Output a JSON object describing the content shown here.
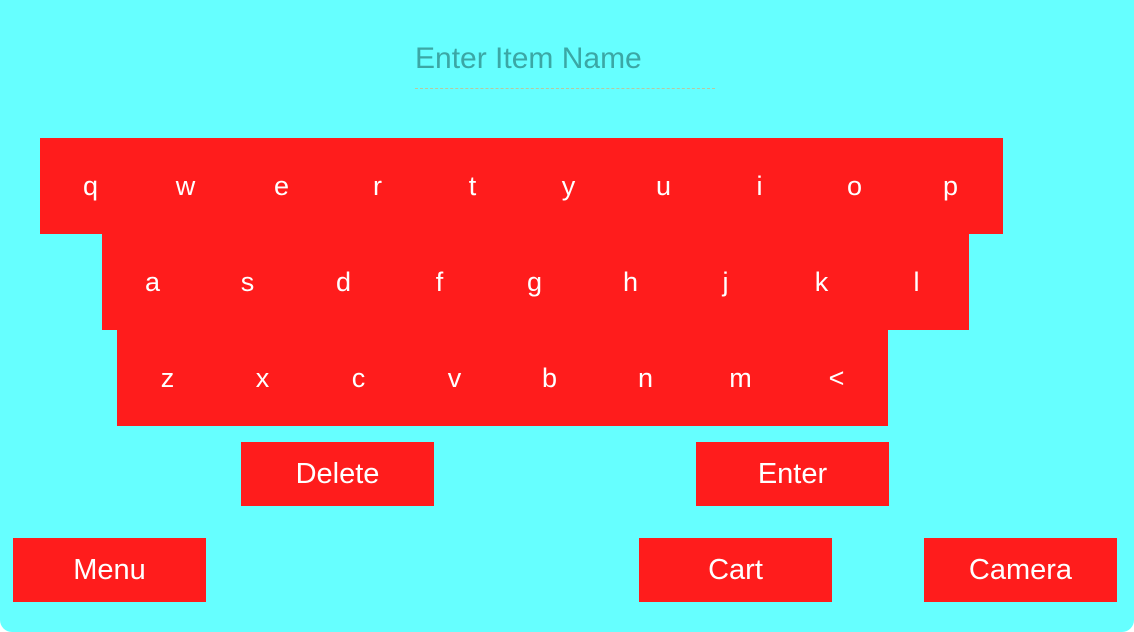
{
  "search": {
    "placeholder": "Enter Item Name",
    "value": ""
  },
  "keyboard": {
    "row1": [
      "q",
      "w",
      "e",
      "r",
      "t",
      "y",
      "u",
      "i",
      "o",
      "p"
    ],
    "row2": [
      "a",
      "s",
      "d",
      "f",
      "g",
      "h",
      "j",
      "k",
      "l"
    ],
    "row3": [
      "z",
      "x",
      "c",
      "v",
      "b",
      "n",
      "m",
      "<"
    ]
  },
  "actions": {
    "delete_label": "Delete",
    "enter_label": "Enter"
  },
  "nav": {
    "menu_label": "Menu",
    "cart_label": "Cart",
    "camera_label": "Camera"
  },
  "colors": {
    "background": "#66ffff",
    "key_fill": "#ff1c1c",
    "key_text": "#ffffff",
    "placeholder_text": "#3ba7a5"
  }
}
